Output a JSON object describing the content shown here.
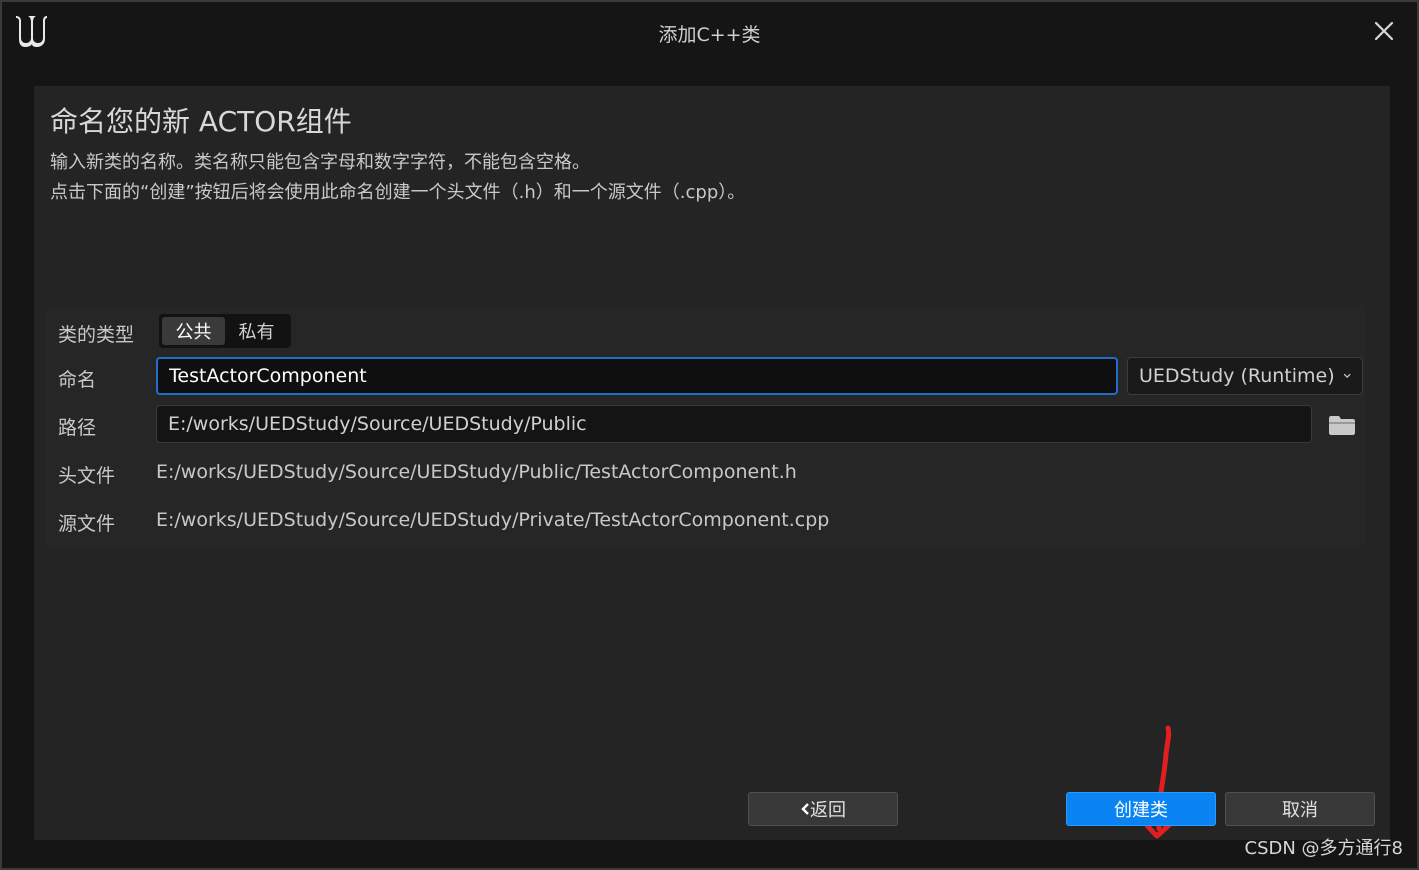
{
  "window": {
    "title": "添加C++类"
  },
  "page": {
    "heading": "命名您的新 ACTOR组件",
    "description_line1": "输入新类的名称。类名称只能包含字母和数字字符，不能包含空格。",
    "description_line2": "点击下面的“创建”按钮后将会使用此命名创建一个头文件（.h）和一个源文件（.cpp）。"
  },
  "form": {
    "class_type_label": "类的类型",
    "class_type_options": [
      "公共",
      "私有"
    ],
    "class_type_selected": "公共",
    "name_label": "命名",
    "name_value": "TestActorComponent",
    "module_selected": "UEDStudy (Runtime)",
    "path_label": "路径",
    "path_value": "E:/works/UEDStudy/Source/UEDStudy/Public",
    "header_label": "头文件",
    "header_value": "E:/works/UEDStudy/Source/UEDStudy/Public/TestActorComponent.h",
    "source_label": "源文件",
    "source_value": "E:/works/UEDStudy/Source/UEDStudy/Private/TestActorComponent.cpp"
  },
  "buttons": {
    "back": "返回",
    "create": "创建类",
    "cancel": "取消"
  },
  "icons": {
    "logo": "unreal-engine-logo",
    "close": "close-icon",
    "dropdown": "chevron-down-icon",
    "folder": "folder-icon",
    "back": "chevron-left-icon",
    "annotation": "red-arrow-annotation"
  },
  "colors": {
    "primary_button": "#0a84f2",
    "input_focus": "#1f6fc9",
    "annotation": "#e02020"
  },
  "watermark": "CSDN @多方通行8"
}
